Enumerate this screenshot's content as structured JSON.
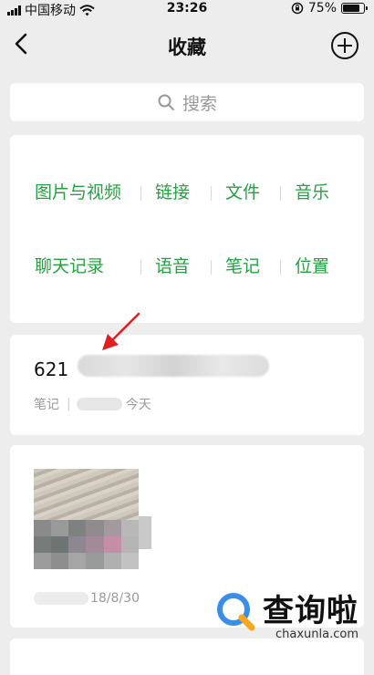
{
  "status_bar": {
    "carrier": "中国移动",
    "time": "23:26",
    "battery_text": "75%",
    "battery_level": 0.75
  },
  "nav": {
    "title": "收藏",
    "back_icon": "chevron-left-icon",
    "add_icon": "plus-circle-icon"
  },
  "search": {
    "placeholder": "搜索",
    "icon": "search-icon"
  },
  "categories": {
    "row1": [
      "图片与视频",
      "链接",
      "文件",
      "音乐"
    ],
    "row2": [
      "聊天记录",
      "语音",
      "笔记",
      "位置"
    ],
    "color": "#26a142"
  },
  "items": [
    {
      "title_visible": "621",
      "type_label": "笔记",
      "date": "今天"
    },
    {
      "date_visible": "18/8/30"
    }
  ],
  "watermark": {
    "name": "查询啦",
    "url": "chaxunla.com"
  },
  "colors": {
    "accent_green": "#26a142",
    "arrow_red": "#e02020",
    "background": "#ededed"
  }
}
